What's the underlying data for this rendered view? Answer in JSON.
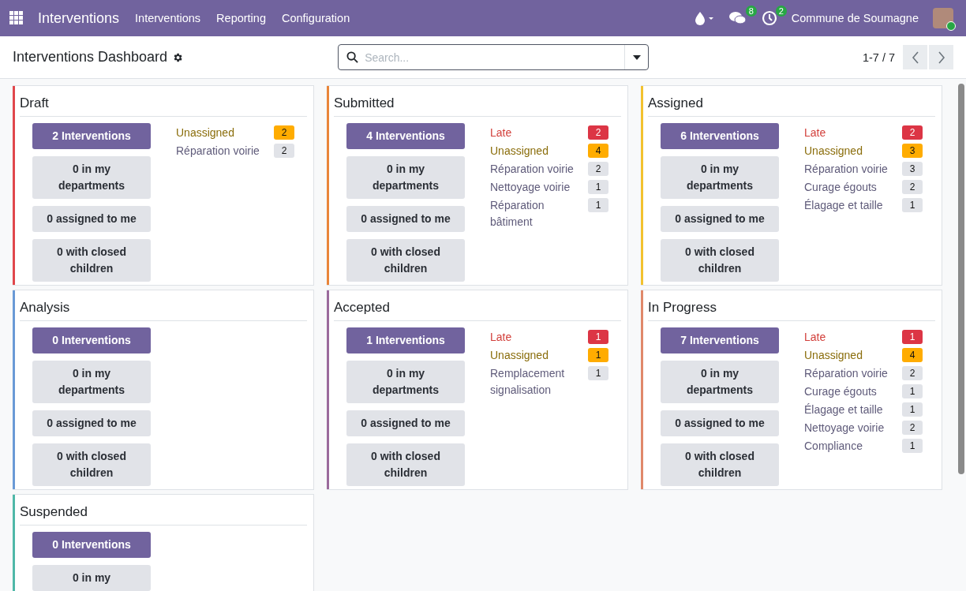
{
  "navbar": {
    "app_name": "Interventions",
    "menu": [
      "Interventions",
      "Reporting",
      "Configuration"
    ],
    "messages_badge": "8",
    "activities_badge": "2",
    "company": "Commune de Soumagne"
  },
  "control_panel": {
    "title": "Interventions Dashboard",
    "search": {
      "placeholder": "Search..."
    },
    "pager": "1-7 / 7"
  },
  "cards": [
    {
      "title": "Draft",
      "color": "#e0474c",
      "buttons": [
        "2 Interventions",
        "0 in my departments",
        "0 assigned to me",
        "0 with closed children"
      ],
      "stats": [
        {
          "kind": "unassigned",
          "label": "Unassigned",
          "count": "2"
        },
        {
          "kind": "category",
          "label": "Réparation voirie",
          "count": "2"
        }
      ]
    },
    {
      "title": "Submitted",
      "color": "#e9853a",
      "buttons": [
        "4 Interventions",
        "0 in my departments",
        "0 assigned to me",
        "0 with closed children"
      ],
      "stats": [
        {
          "kind": "late",
          "label": "Late",
          "count": "2"
        },
        {
          "kind": "unassigned",
          "label": "Unassigned",
          "count": "4"
        },
        {
          "kind": "category",
          "label": "Réparation voirie",
          "count": "2"
        },
        {
          "kind": "category",
          "label": "Nettoyage voirie",
          "count": "1"
        },
        {
          "kind": "category",
          "label": "Réparation bâtiment",
          "count": "1"
        }
      ]
    },
    {
      "title": "Assigned",
      "color": "#f2c12e",
      "buttons": [
        "6 Interventions",
        "0 in my departments",
        "0 assigned to me",
        "0 with closed children"
      ],
      "stats": [
        {
          "kind": "late",
          "label": "Late",
          "count": "2"
        },
        {
          "kind": "unassigned",
          "label": "Unassigned",
          "count": "3"
        },
        {
          "kind": "category",
          "label": "Réparation voirie",
          "count": "3"
        },
        {
          "kind": "category",
          "label": "Curage égouts",
          "count": "2"
        },
        {
          "kind": "category",
          "label": "Élagage et taille",
          "count": "1"
        }
      ]
    },
    {
      "title": "Analysis",
      "color": "#6a9ad6",
      "buttons": [
        "0 Interventions",
        "0 in my departments",
        "0 assigned to me",
        "0 with closed children"
      ]
    },
    {
      "title": "Accepted",
      "color": "#9a6a9c",
      "buttons": [
        "1 Interventions",
        "0 in my departments",
        "0 assigned to me",
        "0 with closed children"
      ],
      "stats": [
        {
          "kind": "late",
          "label": "Late",
          "count": "1"
        },
        {
          "kind": "unassigned",
          "label": "Unassigned",
          "count": "1"
        },
        {
          "kind": "category",
          "label": "Remplacement signalisation",
          "count": "1"
        }
      ]
    },
    {
      "title": "In Progress",
      "color": "#e0886a",
      "buttons": [
        "7 Interventions",
        "0 in my departments",
        "0 assigned to me",
        "0 with closed children"
      ],
      "stats": [
        {
          "kind": "late",
          "label": "Late",
          "count": "1"
        },
        {
          "kind": "unassigned",
          "label": "Unassigned",
          "count": "4"
        },
        {
          "kind": "category",
          "label": "Réparation voirie",
          "count": "2"
        },
        {
          "kind": "category",
          "label": "Curage égouts",
          "count": "1"
        },
        {
          "kind": "category",
          "label": "Élagage et taille",
          "count": "1"
        },
        {
          "kind": "category",
          "label": "Nettoyage voirie",
          "count": "2"
        },
        {
          "kind": "category",
          "label": "Compliance",
          "count": "1"
        }
      ]
    },
    {
      "title": "Suspended",
      "color": "#4fb8a8",
      "buttons": [
        "0 Interventions",
        "0 in my"
      ]
    }
  ]
}
